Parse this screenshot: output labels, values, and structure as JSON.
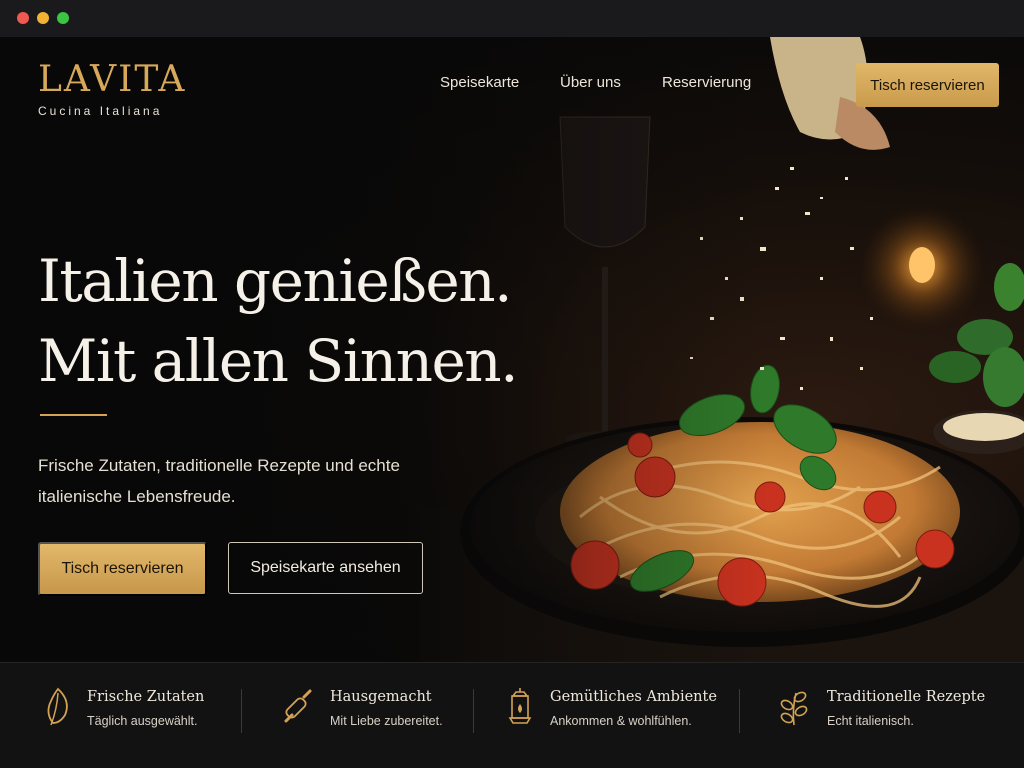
{
  "window": {
    "controls": [
      "close",
      "minimize",
      "maximize"
    ]
  },
  "brand": {
    "name": "LAVITA",
    "tagline": "Cucina Italiana",
    "accent": "#d7a85a"
  },
  "nav": {
    "items": [
      {
        "label": "Speisekarte"
      },
      {
        "label": "Über uns"
      },
      {
        "label": "Reservierung"
      }
    ],
    "cta_label": "Tisch reservieren"
  },
  "hero": {
    "headline_line1": "Italien genießen.",
    "headline_line2": "Mit allen Sinnen.",
    "subtext": "Frische Zutaten, traditionelle Rezepte und echte italienische Lebensfreude.",
    "primary_button": "Tisch reservieren",
    "secondary_button": "Speisekarte ansehen",
    "image": "pasta-plate-with-basil-and-parmesan"
  },
  "features": [
    {
      "icon": "leaf-icon",
      "title": "Frische Zutaten",
      "desc": "Täglich ausgewählt."
    },
    {
      "icon": "rolling-pin-icon",
      "title": "Hausgemacht",
      "desc": "Mit Liebe zubereitet."
    },
    {
      "icon": "lantern-icon",
      "title": "Gemütliches Ambiente",
      "desc": "Ankommen & wohlfühlen."
    },
    {
      "icon": "herb-icon",
      "title": "Traditionelle Rezepte",
      "desc": "Echt italienisch."
    }
  ],
  "colors": {
    "gold": "#d4a254",
    "background": "#0c0b0a",
    "bar": "#121213"
  }
}
